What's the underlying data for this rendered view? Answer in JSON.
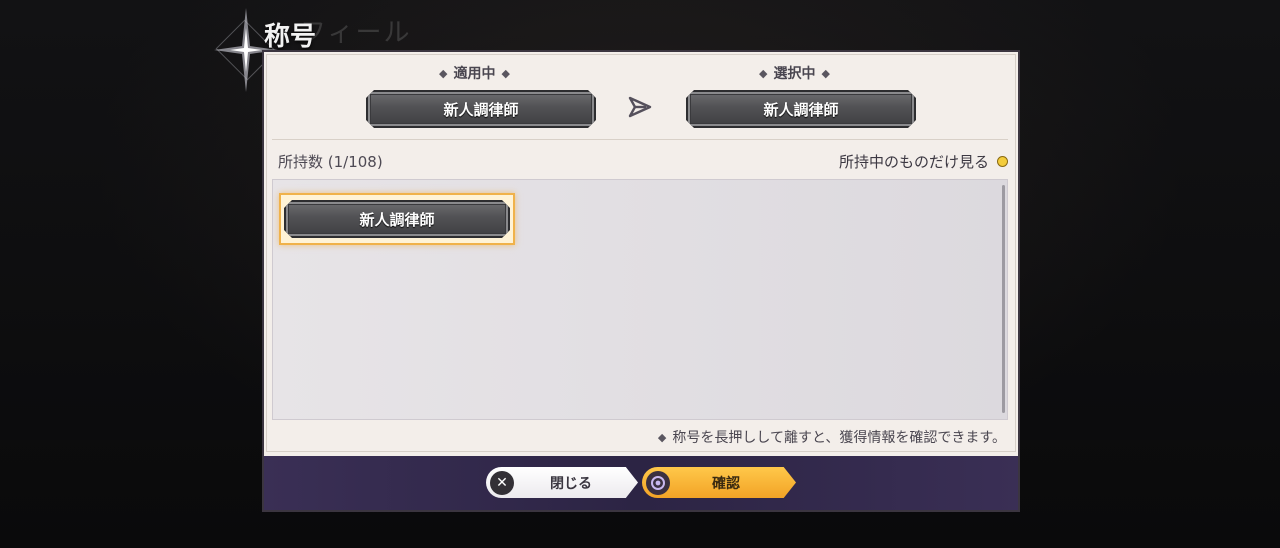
{
  "header": {
    "title": "称号",
    "ghost_title": "フィール"
  },
  "current": {
    "applied_label": "適用中",
    "applied_value": "新人調律師",
    "selected_label": "選択中",
    "selected_value": "新人調律師"
  },
  "list": {
    "count_label": "所持数 (1/108)",
    "filter_label": "所持中のものだけ見る",
    "items": [
      {
        "label": "新人調律師",
        "selected": true
      }
    ]
  },
  "hint": "称号を長押しして離すと、獲得情報を確認できます。",
  "footer": {
    "close_label": "閉じる",
    "confirm_label": "確認"
  },
  "colors": {
    "accent": "#f2a326",
    "panel_bg": "#f3eeea",
    "footer_bg": "#2c2444",
    "filter_dot": "#f3cc3c"
  }
}
